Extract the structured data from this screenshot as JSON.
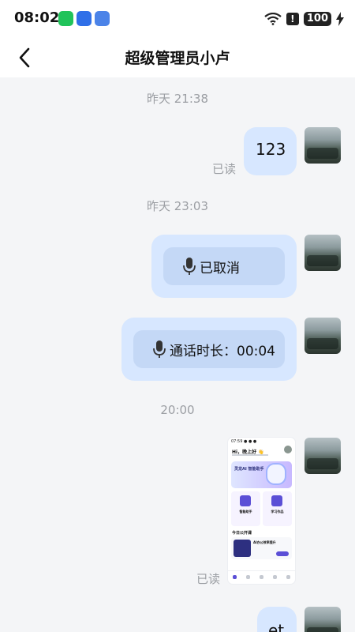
{
  "status_bar": {
    "time": "08:02",
    "battery": "100",
    "alert": "!"
  },
  "nav": {
    "title": "超级管理员小卢"
  },
  "messages": {
    "ts1": "昨天 21:38",
    "msg1_text": "123",
    "msg1_read": "已读",
    "ts2": "昨天 23:03",
    "voice1_text": "已取消",
    "voice2_text": "通话时长：00:04",
    "ts3": "20:00",
    "image_read": "已读",
    "partial_text": "et"
  },
  "thumbnail": {
    "status": "07:59 ● ● ●",
    "greeting": "Hi，晚上好 👋",
    "banner": "灵龙AI 智能助手",
    "card1": "智能助手",
    "card2": "学习作品",
    "section": "今日公开课",
    "course": "AI办公效率提升"
  },
  "icons": {
    "back": "chevron-left-icon",
    "mic": "microphone-icon",
    "avatar": "avatar-image"
  },
  "colors": {
    "bubble": "#d7e7ff",
    "voice_pill": "#c4d8f6",
    "background": "#f4f5f7",
    "meta_text": "#9b9ea3"
  }
}
